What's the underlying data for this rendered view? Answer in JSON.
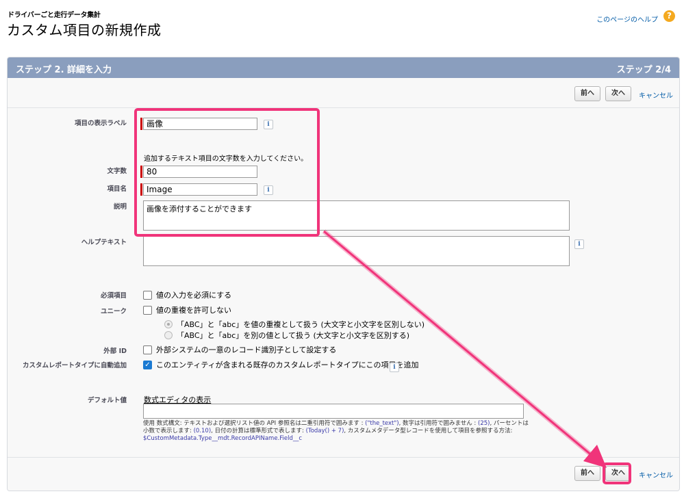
{
  "header": {
    "subtitle": "ドライバーごと走行データ集計",
    "title": "カスタム項目の新規作成",
    "help_link": "このページのヘルプ",
    "help_icon": "?"
  },
  "panel": {
    "step_title": "ステップ 2. 詳細を入力",
    "step_num": "ステップ 2/4"
  },
  "buttons": {
    "prev": "前へ",
    "next": "次へ",
    "cancel": "キャンセル"
  },
  "form": {
    "field_label": {
      "label": "項目の表示ラベル",
      "value": "画像"
    },
    "length_instruction": "追加するテキスト項目の文字数を入力してください。",
    "length": {
      "label": "文字数",
      "value": "80"
    },
    "api_name": {
      "label": "項目名",
      "value": "Image"
    },
    "description": {
      "label": "説明",
      "value": "画像を添付することができます"
    },
    "help_text": {
      "label": "ヘルプテキスト",
      "value": ""
    },
    "required": {
      "label": "必須項目",
      "option": "値の入力を必須にする",
      "checked": false
    },
    "unique": {
      "label": "ユニーク",
      "option": "値の重複を許可しない",
      "checked": false,
      "radio1": "「ABC」と「abc」を値の重複として扱う (大文字と小文字を区別しない)",
      "radio2": "「ABC」と「abc」を別の値として扱う (大文字と小文字を区別する)"
    },
    "external_id": {
      "label": "外部 ID",
      "option": "外部システムの一意のレコード識別子として設定する",
      "checked": false
    },
    "auto_add": {
      "label": "カスタムレポートタイプに自動追加",
      "option": "このエンティティが含まれる既存のカスタムレポートタイプにこの項目を追加",
      "checked": true
    },
    "default_value": {
      "label": "デフォルト値",
      "formula_link": "数式エディタの表示",
      "value": "",
      "syntax_1": "使用 数式構文: テキストおよび選択リスト値の API 参照名は二重引用符で囲みます : ",
      "syntax_code_1": "(\"the_text\")",
      "syntax_2": ", 数字は引用符で囲みません : ",
      "syntax_code_2": "(25)",
      "syntax_3": ", パーセントは小数で表示します: ",
      "syntax_code_3": "(0.10)",
      "syntax_4": ", 日付の計算は標準形式で表します: ",
      "syntax_code_4": "(Today() + 7)",
      "syntax_5": ", カスタムメタデータ型レコードを使用して項目を参照する方法: ",
      "syntax_code_5": "$CustomMetadata.Type__mdt.RecordAPIName.Field__c"
    }
  },
  "icons": {
    "info": "i",
    "check": "✓"
  },
  "colors": {
    "header_bar": "#8a9ebe",
    "highlight": "#f0347a",
    "link": "#015ba7",
    "required": "#cc0000"
  }
}
